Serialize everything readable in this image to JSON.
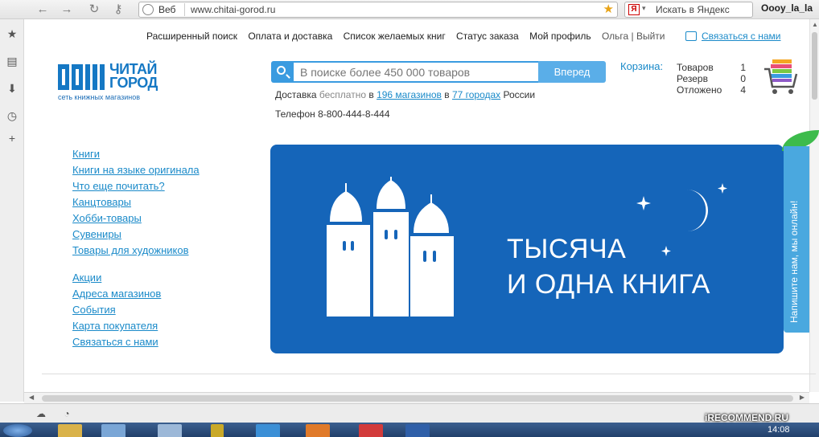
{
  "browser": {
    "nav_back": "←",
    "nav_forward": "→",
    "nav_reload": "↻",
    "nav_key": "⚷",
    "address_label": "Веб",
    "url": "www.chitai-gorod.ru",
    "search_placeholder": "Искать в Яндекс",
    "search_engine_letter": "Я",
    "user": "Oooy_la_la"
  },
  "sidebar_icons": [
    "star-icon",
    "note-icon",
    "download-icon",
    "clock-icon",
    "plus-icon"
  ],
  "toplinks": {
    "items": [
      "Расширенный поиск",
      "Оплата и доставка",
      "Список желаемых книг",
      "Статус заказа",
      "Мой профиль"
    ],
    "user": "Ольга | Выйти",
    "contact": "Связаться с нами"
  },
  "logo": {
    "line1": "ЧИТАЙ",
    "line2": "ГОРОД",
    "sub": "сеть книжных магазинов"
  },
  "search": {
    "placeholder": "В поиске более 450 000 товаров",
    "button": "Вперед"
  },
  "delivery": {
    "part1": "Доставка",
    "part2": "бесплатно",
    "part3": "в",
    "stores": "196 магазинов",
    "part4": "в",
    "cities": "77 городах",
    "part5": "России"
  },
  "phone": "Телефон 8-800-444-8-444",
  "cart": {
    "label": "Корзина:",
    "rows": [
      {
        "name": "Товаров",
        "value": "1"
      },
      {
        "name": "Резерв",
        "value": "0"
      },
      {
        "name": "Отложено",
        "value": "4"
      }
    ]
  },
  "categories": [
    "Книги",
    "Книги на языке оригинала",
    "Что еще почитать?",
    "Канцтовары",
    "Хобби-товары",
    "Сувениры",
    "Товары для художников"
  ],
  "links2": [
    "Акции",
    "Адреса магазинов",
    "События",
    "Карта покупателя",
    "Связаться с нами"
  ],
  "banner": {
    "line1": "ТЫСЯЧА",
    "line2": "И ОДНА КНИГА",
    "color": "#1565b9"
  },
  "chat_tab": "Напишите нам, мы онлайн!",
  "taskbar": {
    "clock": "14:08"
  },
  "watermark": "iRECOMMEND.RU"
}
